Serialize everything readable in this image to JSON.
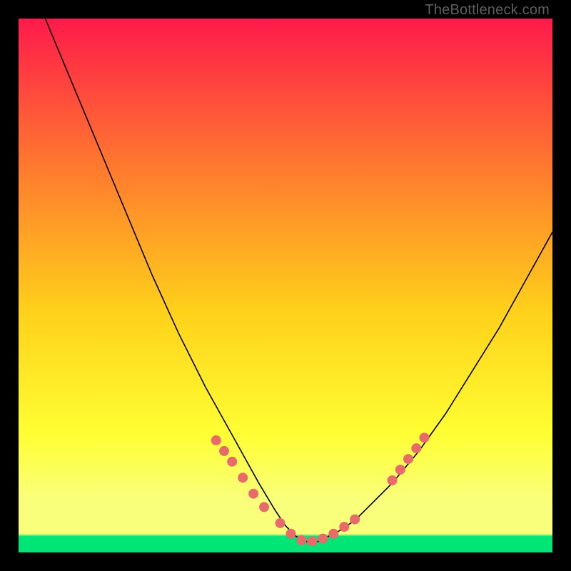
{
  "watermark": "TheBottleneck.com",
  "colors": {
    "gradient_top": "#ff1a4b",
    "gradient_mid1": "#ff7a2e",
    "gradient_mid2": "#ffd11a",
    "gradient_mid3": "#ffff33",
    "gradient_low_yellow": "#f9ff7a",
    "gradient_green_band": "#00e676",
    "curve_stroke": "#000000",
    "marker_fill": "#e86a6a",
    "background": "#000000"
  },
  "chart_data": {
    "type": "line",
    "title": "",
    "xlabel": "",
    "ylabel": "",
    "xlim": [
      0,
      100
    ],
    "ylim": [
      0,
      100
    ],
    "notes": "V-shaped bottleneck curve on rainbow gradient; minimum near x≈54; salmon-colored markers highlight the low region and the right rising branch near y≈20.",
    "series": [
      {
        "name": "bottleneck-curve",
        "x": [
          5,
          10,
          15,
          20,
          25,
          30,
          35,
          40,
          45,
          48,
          50,
          52,
          54,
          56,
          58,
          60,
          63,
          66,
          70,
          75,
          80,
          85,
          90,
          95,
          100
        ],
        "y": [
          100,
          88,
          76,
          64,
          52,
          41,
          31,
          22,
          13,
          8,
          5,
          3,
          2,
          2,
          3,
          4,
          6,
          9,
          13,
          19,
          26,
          34,
          42,
          51,
          60
        ]
      }
    ],
    "markers": [
      {
        "x": 37,
        "y": 21
      },
      {
        "x": 38.5,
        "y": 19
      },
      {
        "x": 40,
        "y": 17
      },
      {
        "x": 42,
        "y": 14
      },
      {
        "x": 44,
        "y": 11
      },
      {
        "x": 46,
        "y": 8.5
      },
      {
        "x": 49,
        "y": 5.5
      },
      {
        "x": 51,
        "y": 3.5
      },
      {
        "x": 53,
        "y": 2.3
      },
      {
        "x": 55,
        "y": 2.1
      },
      {
        "x": 57,
        "y": 2.6
      },
      {
        "x": 59,
        "y": 3.5
      },
      {
        "x": 61,
        "y": 4.8
      },
      {
        "x": 63,
        "y": 6.2
      },
      {
        "x": 70,
        "y": 13.5
      },
      {
        "x": 71.5,
        "y": 15.5
      },
      {
        "x": 73,
        "y": 17.5
      },
      {
        "x": 74.5,
        "y": 19.5
      },
      {
        "x": 76,
        "y": 21.5
      }
    ],
    "marker_radius_px": 7
  }
}
